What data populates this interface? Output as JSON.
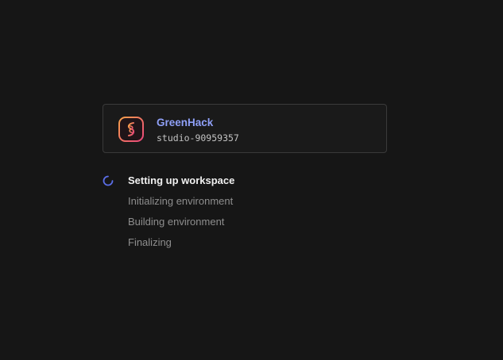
{
  "project": {
    "name": "GreenHack",
    "id": "studio-90959357",
    "logo_icon": "studio-logo-icon"
  },
  "steps": [
    {
      "label": "Setting up workspace",
      "status": "in-progress",
      "icon": "loading-spinner-icon"
    },
    {
      "label": "Initializing environment",
      "status": "pending"
    },
    {
      "label": "Building environment",
      "status": "pending"
    },
    {
      "label": "Finalizing",
      "status": "pending"
    }
  ],
  "colors": {
    "background": "#161616",
    "card_border": "#3a3a3a",
    "accent": "#8fa0f7",
    "spinner": "#5b6ee8",
    "logo_gradient_start": "#f7a24a",
    "logo_gradient_end": "#e8457a"
  }
}
